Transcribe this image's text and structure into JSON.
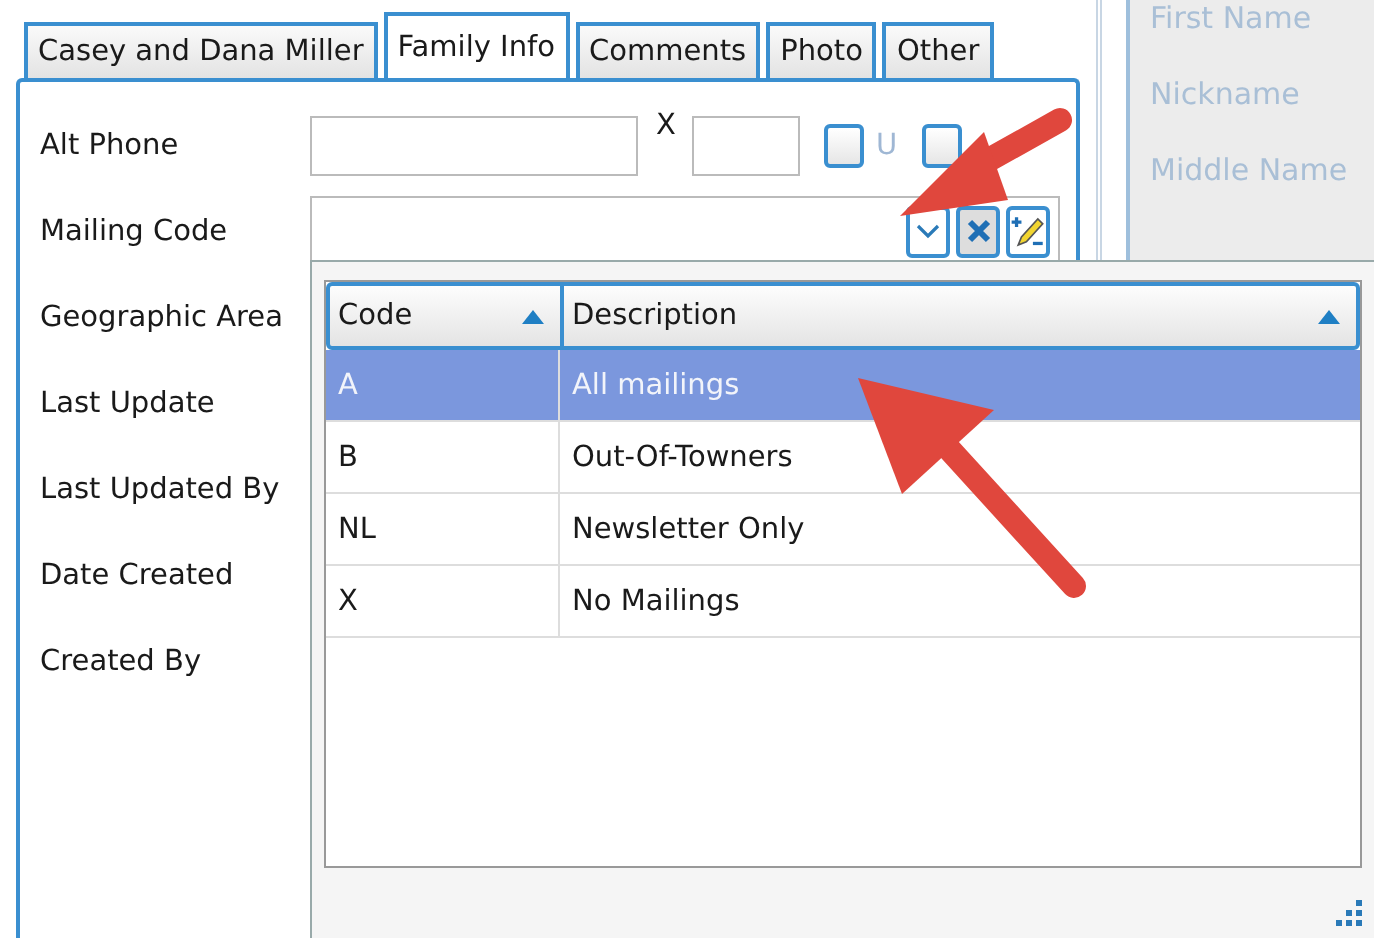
{
  "tabs": [
    {
      "label": "Casey and Dana Miller",
      "selected": false
    },
    {
      "label": "Family Info",
      "selected": true
    },
    {
      "label": "Comments",
      "selected": false
    },
    {
      "label": "Photo",
      "selected": false
    },
    {
      "label": "Other",
      "selected": false
    }
  ],
  "fields": [
    {
      "label": "Alt Phone",
      "kind": "phone",
      "extension_label": "X",
      "checkboxes": [
        {
          "label": "U",
          "checked": false
        },
        {
          "checked": false
        }
      ]
    },
    {
      "label": "Mailing Code",
      "kind": "lookup"
    },
    {
      "label": "Geographic Area",
      "kind": "plain"
    },
    {
      "label": "Last Update",
      "kind": "plain"
    },
    {
      "label": "Last Updated By",
      "kind": "plain"
    },
    {
      "label": "Date Created",
      "kind": "plain"
    },
    {
      "label": "Created By",
      "kind": "plain"
    }
  ],
  "side_fields": [
    {
      "label": "First Name"
    },
    {
      "label": "Nickname"
    },
    {
      "label": "Middle Name"
    }
  ],
  "dropdown": {
    "columns": [
      {
        "label": "Code",
        "sorted_ascending": true
      },
      {
        "label": "Description",
        "sorted_ascending": true
      }
    ],
    "rows": [
      {
        "code": "A",
        "description": "All mailings",
        "selected": true
      },
      {
        "code": "B",
        "description": "Out-Of-Towners",
        "selected": false
      },
      {
        "code": "NL",
        "description": "Newsletter Only",
        "selected": false
      },
      {
        "code": "X",
        "description": "No Mailings",
        "selected": false
      }
    ]
  }
}
